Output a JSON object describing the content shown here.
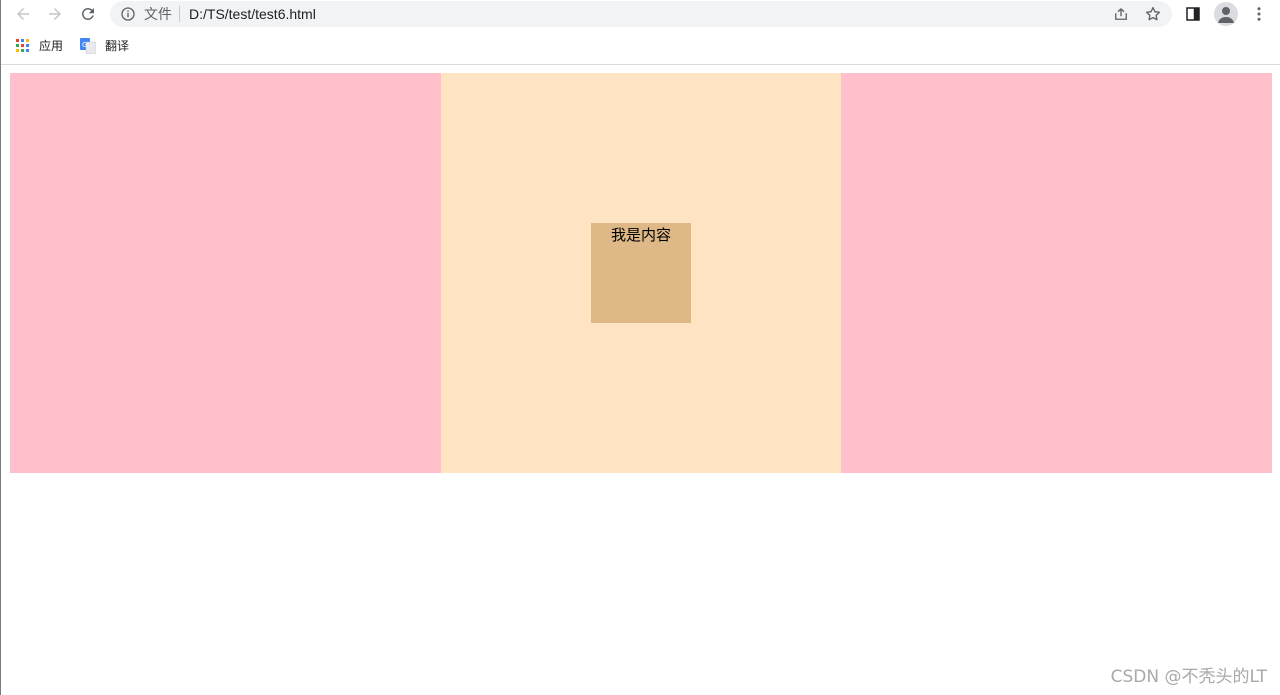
{
  "browser": {
    "address_chip": "文件",
    "url": "D:/TS/test/test6.html"
  },
  "bookmarks": [
    {
      "label": "应用",
      "icon": "apps-grid-icon"
    },
    {
      "label": "翻译",
      "icon": "google-translate-icon"
    }
  ],
  "page": {
    "content_text": "我是内容",
    "colors": {
      "side_columns": "#ffc0cb",
      "middle_column": "#ffe4c4",
      "content_box": "#deb887"
    }
  },
  "watermark": "CSDN @不秃头的LT"
}
